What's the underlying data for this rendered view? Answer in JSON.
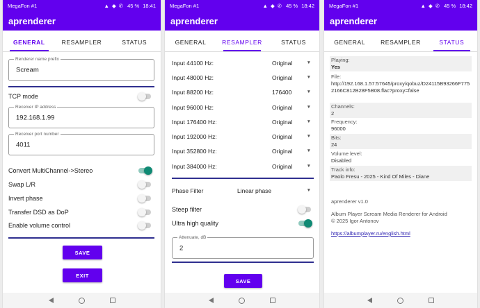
{
  "status": {
    "p1": {
      "carrier": "MegaFon #1",
      "icons": "▲ ◆ ✆",
      "battery": "45 %",
      "time": "18:41"
    },
    "p2": {
      "carrier": "MegaFon #1",
      "icons": "▲ ◆ ✆",
      "battery": "45 %",
      "time": "18:42"
    },
    "p3": {
      "carrier": "MegaFon #1",
      "icons": "▲ ◆ ✆",
      "battery": "45 %",
      "time": "18:42"
    }
  },
  "app_title": "aprenderer",
  "tabs": [
    "GENERAL",
    "RESAMPLER",
    "STATUS"
  ],
  "general": {
    "name_prefix": {
      "label": "Renderer name prefix",
      "value": "Scream"
    },
    "tcp_mode": "TCP mode",
    "receiver_ip": {
      "label": "Receiver IP address",
      "value": "192.168.1.99"
    },
    "receiver_port": {
      "label": "Receiver port number",
      "value": "4011"
    },
    "toggles": [
      {
        "label": "Convert MultiChannel->Stereo",
        "on": true
      },
      {
        "label": "Swap L/R",
        "on": false
      },
      {
        "label": "Invert phase",
        "on": false
      },
      {
        "label": "Transfer DSD as DoP",
        "on": false
      },
      {
        "label": "Enable volume control",
        "on": false
      }
    ],
    "save": "SAVE",
    "exit": "EXIT"
  },
  "resampler": {
    "rates": [
      {
        "label": "Input 44100 Hz:",
        "value": "Original"
      },
      {
        "label": "Input 48000 Hz:",
        "value": "Original"
      },
      {
        "label": "Input 88200 Hz:",
        "value": "176400"
      },
      {
        "label": "Input 96000 Hz:",
        "value": "Original"
      },
      {
        "label": "Input 176400 Hz:",
        "value": "Original"
      },
      {
        "label": "Input 192000 Hz:",
        "value": "Original"
      },
      {
        "label": "Input 352800 Hz:",
        "value": "Original"
      },
      {
        "label": "Input 384000 Hz:",
        "value": "Original"
      }
    ],
    "caret": "▼",
    "phase_filter": {
      "label": "Phase Filter",
      "value": "Linear phase"
    },
    "steep_filter": {
      "label": "Steep filter",
      "on": false
    },
    "ultra_high": {
      "label": "Ultra high quality",
      "on": true
    },
    "attenuate": {
      "label": "Attenuate, dB",
      "value": "2"
    },
    "save": "SAVE"
  },
  "status_tab": {
    "rows": [
      {
        "label": "Playing:",
        "value": "Yes",
        "bold": true
      },
      {
        "label": "File:",
        "value": "http://192.168.1.57:57645/proxy/qobuz/D24115B93266F7752166C812B28F5B08.flac?proxy=false"
      },
      {
        "label": "Channels:",
        "value": "2"
      },
      {
        "label": "Frequency:",
        "value": "96000"
      },
      {
        "label": "Bits:",
        "value": "24"
      },
      {
        "label": "Volume level:",
        "value": "Disabled"
      },
      {
        "label": "Track info:",
        "value": "Paolo Fresu - 2025 - Kind Of Miles - Diane"
      }
    ],
    "version": "aprenderer v1.0",
    "desc": "Album Player Scream Media Renderer for Android",
    "copyright": "© 2025 Igor Antonov",
    "link": "https://albumplayer.ru/english.html"
  },
  "colors": {
    "primary": "#6200ee",
    "toggle_on": "#0f8a74",
    "divider": "#2f2f8f"
  }
}
